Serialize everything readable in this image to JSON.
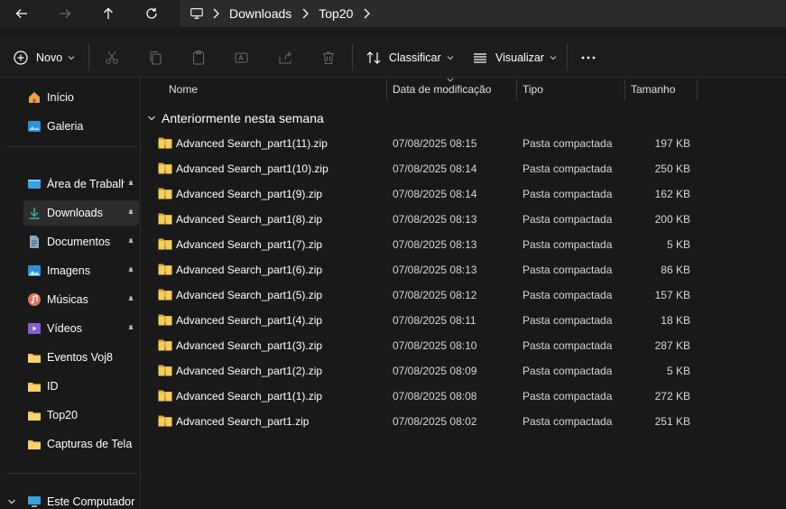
{
  "breadcrumb": [
    "Downloads",
    "Top20"
  ],
  "toolbar": {
    "new_label": "Novo",
    "sort_label": "Classificar",
    "view_label": "Visualizar"
  },
  "sidebar": {
    "items": [
      {
        "label": "Início",
        "icon": "home-icon"
      },
      {
        "label": "Galeria",
        "icon": "gallery-icon"
      },
      {
        "label": "Área de Trabalho",
        "icon": "desktop-icon",
        "pinned": true
      },
      {
        "label": "Downloads",
        "icon": "download-icon",
        "pinned": true,
        "selected": true
      },
      {
        "label": "Documentos",
        "icon": "documents-icon",
        "pinned": true
      },
      {
        "label": "Imagens",
        "icon": "pictures-icon",
        "pinned": true
      },
      {
        "label": "Músicas",
        "icon": "music-icon",
        "pinned": true
      },
      {
        "label": "Vídeos",
        "icon": "videos-icon",
        "pinned": true
      },
      {
        "label": "Eventos Voj8",
        "icon": "folder-icon"
      },
      {
        "label": "ID",
        "icon": "folder-icon"
      },
      {
        "label": "Top20",
        "icon": "folder-icon"
      },
      {
        "label": "Capturas de Tela",
        "icon": "folder-icon"
      },
      {
        "label": "Este Computador",
        "icon": "computer-icon"
      }
    ]
  },
  "columns": {
    "name": "Nome",
    "date": "Data de modificação",
    "type": "Tipo",
    "size": "Tamanho"
  },
  "group_label": "Anteriormente nesta semana",
  "files": [
    {
      "name": "Advanced Search_part1(11).zip",
      "date": "07/08/2025 08:15",
      "type": "Pasta compactada",
      "size": "197 KB"
    },
    {
      "name": "Advanced Search_part1(10).zip",
      "date": "07/08/2025 08:14",
      "type": "Pasta compactada",
      "size": "250 KB"
    },
    {
      "name": "Advanced Search_part1(9).zip",
      "date": "07/08/2025 08:14",
      "type": "Pasta compactada",
      "size": "162 KB"
    },
    {
      "name": "Advanced Search_part1(8).zip",
      "date": "07/08/2025 08:13",
      "type": "Pasta compactada",
      "size": "200 KB"
    },
    {
      "name": "Advanced Search_part1(7).zip",
      "date": "07/08/2025 08:13",
      "type": "Pasta compactada",
      "size": "5 KB"
    },
    {
      "name": "Advanced Search_part1(6).zip",
      "date": "07/08/2025 08:13",
      "type": "Pasta compactada",
      "size": "86 KB"
    },
    {
      "name": "Advanced Search_part1(5).zip",
      "date": "07/08/2025 08:12",
      "type": "Pasta compactada",
      "size": "157 KB"
    },
    {
      "name": "Advanced Search_part1(4).zip",
      "date": "07/08/2025 08:11",
      "type": "Pasta compactada",
      "size": "18 KB"
    },
    {
      "name": "Advanced Search_part1(3).zip",
      "date": "07/08/2025 08:10",
      "type": "Pasta compactada",
      "size": "287 KB"
    },
    {
      "name": "Advanced Search_part1(2).zip",
      "date": "07/08/2025 08:09",
      "type": "Pasta compactada",
      "size": "5 KB"
    },
    {
      "name": "Advanced Search_part1(1).zip",
      "date": "07/08/2025 08:08",
      "type": "Pasta compactada",
      "size": "272 KB"
    },
    {
      "name": "Advanced Search_part1.zip",
      "date": "07/08/2025 08:02",
      "type": "Pasta compactada",
      "size": "251 KB"
    }
  ],
  "colors": {
    "accent": "#4cc2ff",
    "folder": "#f0c24b",
    "background": "#191919"
  }
}
